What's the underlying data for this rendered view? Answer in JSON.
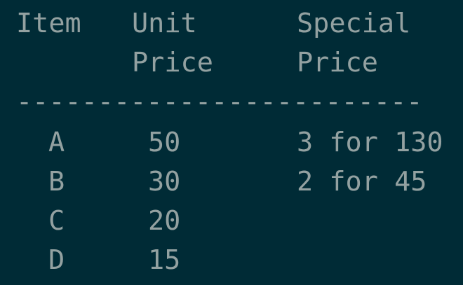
{
  "header": {
    "row1": {
      "item": "Item",
      "unit": "Unit",
      "special": "Special"
    },
    "row2": {
      "unit": "Price",
      "special": "Price"
    }
  },
  "divider": "-------------------------",
  "rows": [
    {
      "item": "A",
      "unit_price": "50",
      "special_price": "3 for 130"
    },
    {
      "item": "B",
      "unit_price": "30",
      "special_price": "2 for 45"
    },
    {
      "item": "C",
      "unit_price": "20",
      "special_price": ""
    },
    {
      "item": "D",
      "unit_price": "15",
      "special_price": ""
    }
  ],
  "colors": {
    "background": "#002b36",
    "text": "#93a1a1"
  }
}
